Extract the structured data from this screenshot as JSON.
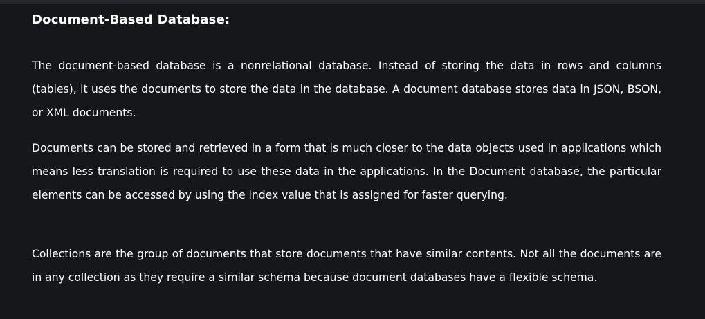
{
  "article": {
    "heading": "Document-Based Database:",
    "paragraphs": [
      "The document-based database is a nonrelational database. Instead of storing the data in rows and columns (tables), it uses the documents to store the data in the database. A document database stores data in JSON, BSON, or XML documents.",
      "Documents can be stored and retrieved in a form that is much closer to the data objects used in applications which means less translation is required to use these data in the applications. In the Document database, the particular elements can be accessed by using the index value that is assigned for faster querying.",
      "Collections are the group of documents that store documents that have similar contents. Not all the documents are in any collection as they require a similar schema because document databases have a flexible schema."
    ]
  },
  "colors": {
    "background": "#16171b",
    "text": "#ffffff"
  }
}
